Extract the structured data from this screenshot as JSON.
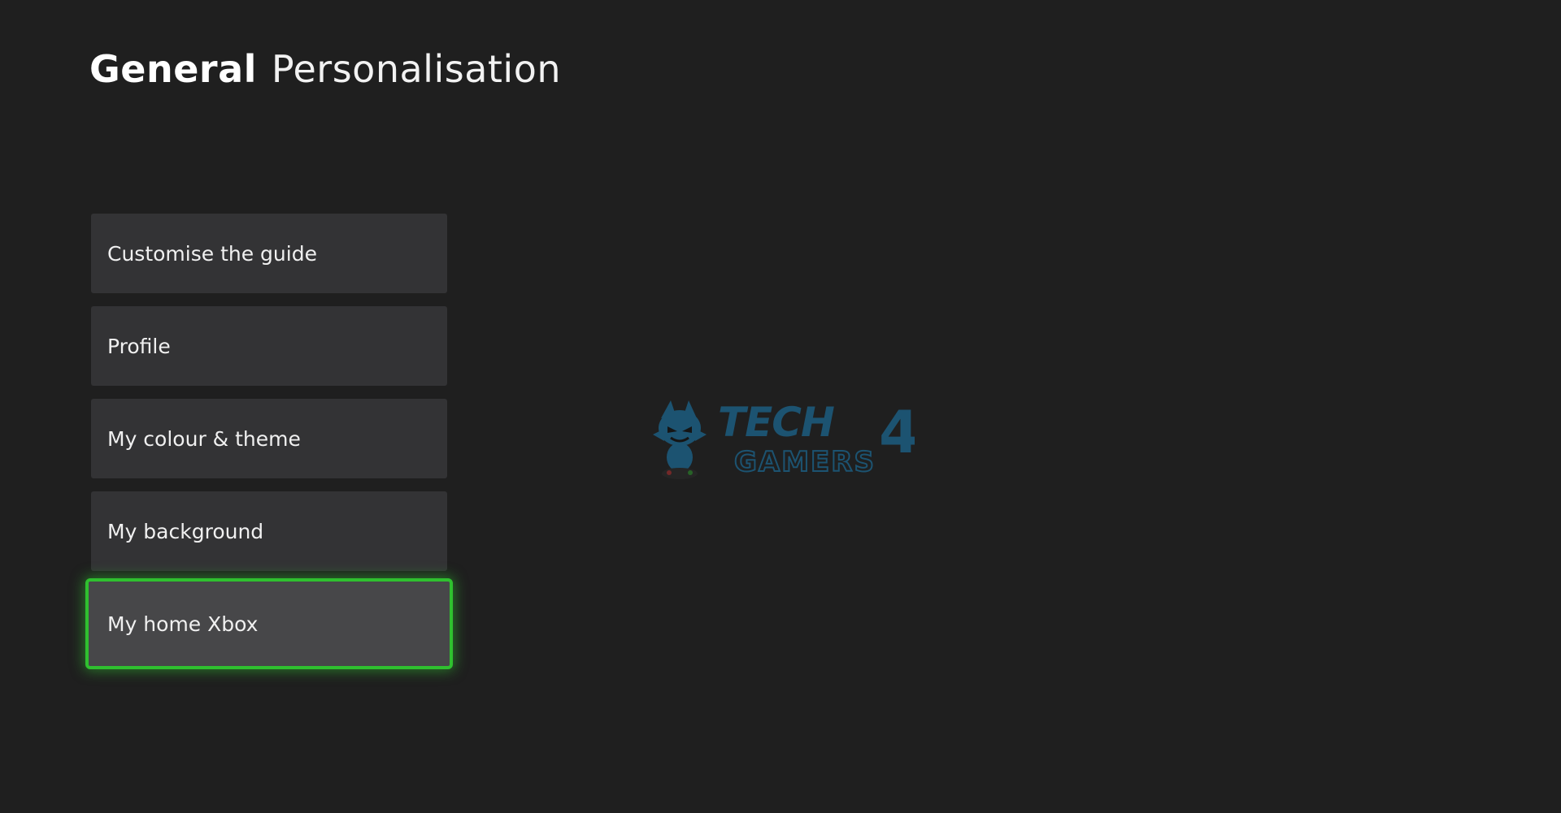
{
  "header": {
    "section": "General",
    "subsection": "Personalisation"
  },
  "menu": {
    "items": [
      {
        "label": "Customise the guide",
        "focused": false
      },
      {
        "label": "Profile",
        "focused": false
      },
      {
        "label": "My colour & theme",
        "focused": false
      },
      {
        "label": "My background",
        "focused": false
      },
      {
        "label": "My home Xbox",
        "focused": true
      }
    ]
  },
  "watermark": {
    "line1": "TECH",
    "line2": "GAMERS",
    "number": "4"
  },
  "colors": {
    "background": "#1f1f1f",
    "tile": "#333335",
    "tile_focused": "#474749",
    "focus_accent": "#2fc02f",
    "watermark_blue": "#1b7fb5"
  }
}
